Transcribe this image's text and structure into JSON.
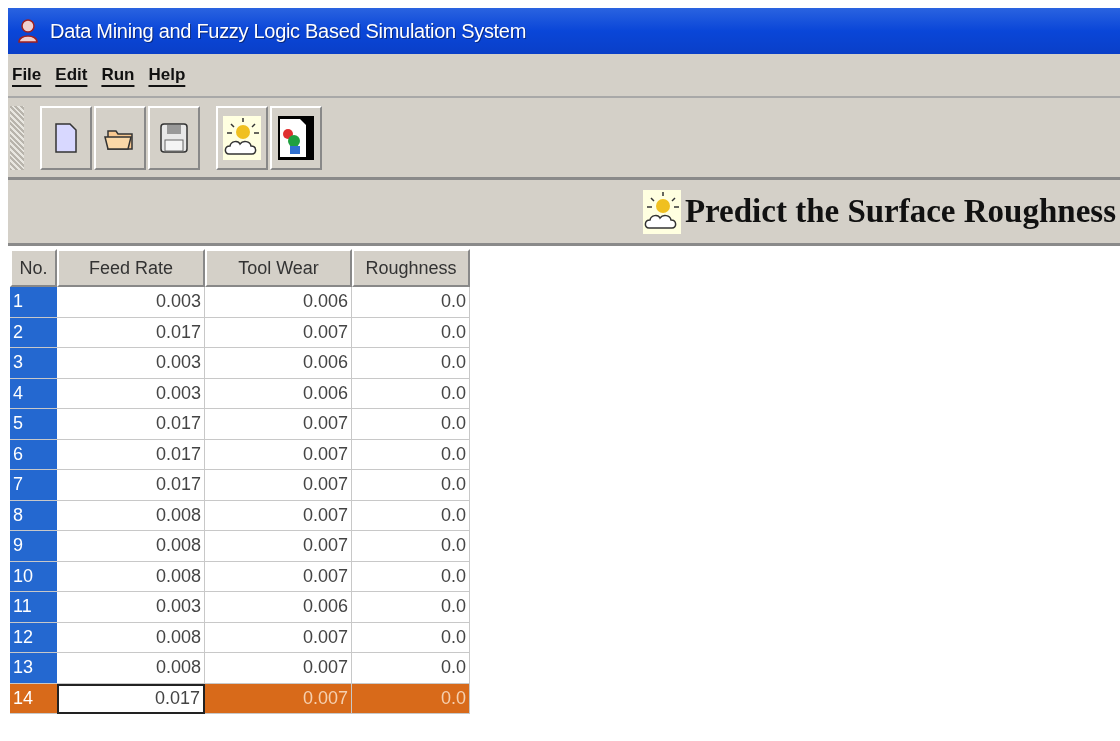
{
  "window": {
    "title": "Data Mining and Fuzzy Logic Based Simulation System"
  },
  "menu": [
    "File",
    "Edit",
    "Run",
    "Help"
  ],
  "toolbar": [
    {
      "kind": "new"
    },
    {
      "kind": "open"
    },
    {
      "kind": "save"
    },
    {
      "kind": "predict"
    },
    {
      "kind": "report"
    }
  ],
  "banner": {
    "title": "Predict the Surface Roughness"
  },
  "table": {
    "columns": [
      "No.",
      "Feed Rate",
      "Tool Wear",
      "Roughness"
    ],
    "rows": [
      {
        "cells": [
          "1",
          "0.003",
          "0.006",
          "0.0"
        ],
        "selected": false
      },
      {
        "cells": [
          "2",
          "0.017",
          "0.007",
          "0.0"
        ],
        "selected": false
      },
      {
        "cells": [
          "3",
          "0.003",
          "0.006",
          "0.0"
        ],
        "selected": false
      },
      {
        "cells": [
          "4",
          "0.003",
          "0.006",
          "0.0"
        ],
        "selected": false
      },
      {
        "cells": [
          "5",
          "0.017",
          "0.007",
          "0.0"
        ],
        "selected": false
      },
      {
        "cells": [
          "6",
          "0.017",
          "0.007",
          "0.0"
        ],
        "selected": false
      },
      {
        "cells": [
          "7",
          "0.017",
          "0.007",
          "0.0"
        ],
        "selected": false
      },
      {
        "cells": [
          "8",
          "0.008",
          "0.007",
          "0.0"
        ],
        "selected": false
      },
      {
        "cells": [
          "9",
          "0.008",
          "0.007",
          "0.0"
        ],
        "selected": false
      },
      {
        "cells": [
          "10",
          "0.008",
          "0.007",
          "0.0"
        ],
        "selected": false
      },
      {
        "cells": [
          "11",
          "0.003",
          "0.006",
          "0.0"
        ],
        "selected": false
      },
      {
        "cells": [
          "12",
          "0.008",
          "0.007",
          "0.0"
        ],
        "selected": false
      },
      {
        "cells": [
          "13",
          "0.008",
          "0.007",
          "0.0"
        ],
        "selected": false
      },
      {
        "cells": [
          "14",
          "0.017",
          "0.007",
          "0.0"
        ],
        "selected": true
      }
    ]
  }
}
